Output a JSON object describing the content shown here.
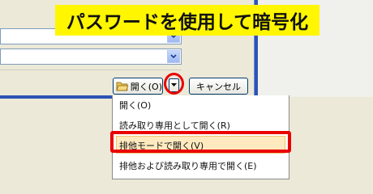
{
  "annotation": {
    "title": "パスワードを使用して暗号化"
  },
  "buttons": {
    "open_label": "開く(O)",
    "cancel_label": "キャンセル"
  },
  "open_menu": {
    "items": [
      {
        "label": "開く(O)"
      },
      {
        "label": "読み取り専用として開く(R)"
      },
      {
        "label": "排他モードで開く(V)",
        "highlighted": true
      },
      {
        "label": "排他および読み取り専用で開く(E)"
      }
    ]
  },
  "icons": {
    "open": "folder-open-icon",
    "dropdown": "triangle-down-icon",
    "combo": "chevron-down-icon"
  },
  "colors": {
    "highlight_marker": "#ea0000",
    "banner_background": "#fff600",
    "menu_hover": "#ffeabf"
  }
}
